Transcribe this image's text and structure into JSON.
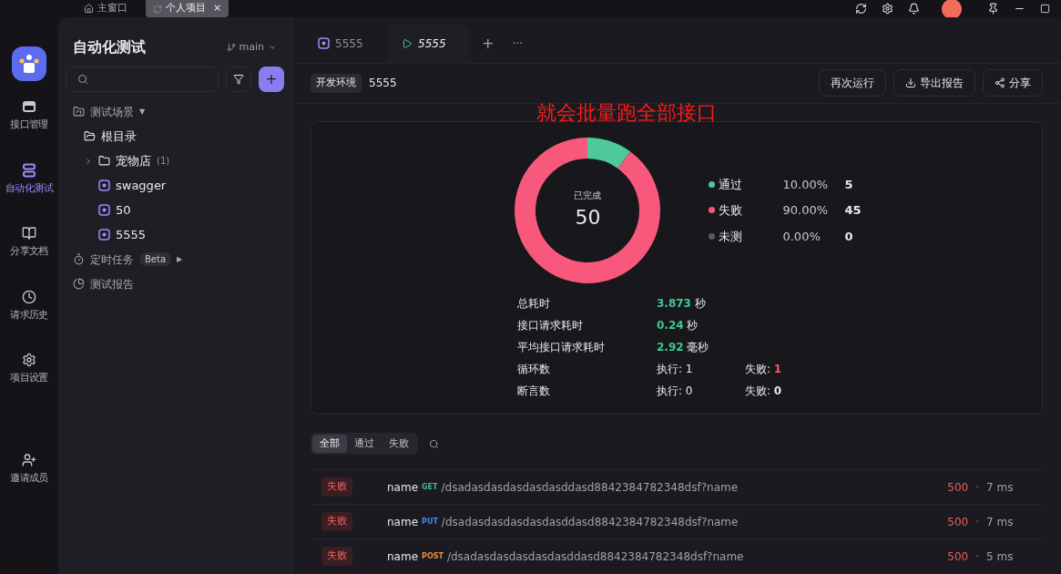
{
  "window_tabs": [
    {
      "label": "主窗口",
      "selected": false
    },
    {
      "label": "个人项目",
      "selected": true,
      "close": "×"
    }
  ],
  "rail": [
    {
      "label": "接口管理",
      "selected": false
    },
    {
      "label": "自动化测试",
      "selected": true
    },
    {
      "label": "分享文档",
      "selected": false
    },
    {
      "label": "请求历史",
      "selected": false
    },
    {
      "label": "项目设置",
      "selected": false
    },
    {
      "label": "邀请成员",
      "selected": false
    }
  ],
  "sidebar": {
    "title": "自动化测试",
    "branch": "main",
    "add": "+",
    "tree": [
      {
        "label": "测试场景",
        "kind": "section",
        "caret": "▼",
        "children": [
          {
            "label": "根目录",
            "kind": "folder",
            "expanded": true,
            "children": [
              {
                "label": "宠物店",
                "count": "(1)",
                "kind": "folder",
                "expanded": false
              },
              {
                "label": "swagger",
                "kind": "case"
              },
              {
                "label": "50",
                "kind": "case"
              },
              {
                "label": "5555",
                "kind": "case"
              }
            ]
          }
        ]
      },
      {
        "label": "定时任务",
        "badge": "Beta",
        "kind": "section",
        "caret": "▶"
      },
      {
        "label": "测试报告",
        "kind": "section"
      }
    ]
  },
  "tabs": [
    {
      "label": "5555",
      "kind": "case",
      "selected": false
    },
    {
      "label": "5555",
      "kind": "report",
      "selected": true
    }
  ],
  "tab_actions": {
    "add": "+",
    "more": "···"
  },
  "toolbar": {
    "env": "开发环境",
    "name": "5555",
    "buttons": [
      {
        "label": "再次运行"
      },
      {
        "label": "导出报告"
      },
      {
        "label": "分享"
      }
    ]
  },
  "caption": "就会批量跑全部接口",
  "summary": {
    "center_label": "已完成",
    "center_value": "50",
    "chart_data": {
      "type": "donut",
      "categories": [
        "通过",
        "失败",
        "未测"
      ],
      "values": [
        10,
        90,
        0
      ]
    },
    "legend": [
      {
        "percent": "10.00%",
        "count": "5",
        "color": "#4ec99a"
      },
      {
        "percent": "90.00%",
        "count": "45",
        "color": "#f7587c"
      },
      {
        "percent": "0.00%",
        "count": "0",
        "color": "#5a5a62"
      }
    ],
    "stats": [
      {
        "label": "总耗时",
        "value": "3.873",
        "unit": "秒"
      },
      {
        "label": "接口请求耗时",
        "value": "0.24",
        "unit": "秒"
      },
      {
        "label": "平均接口请求耗时",
        "value": "2.92",
        "unit": "毫秒"
      },
      {
        "label": "循环数",
        "run": "执行: 1",
        "failed_label": "失败: ",
        "failed": "1",
        "failed_alert": true
      },
      {
        "label": "断言数",
        "run": "执行: 0",
        "failed_label": "失败: ",
        "failed": "0",
        "failed_alert": false
      }
    ]
  },
  "filters": [
    {
      "label": "全部",
      "selected": true
    },
    {
      "label": "通过",
      "selected": false
    },
    {
      "label": "失败",
      "selected": false
    }
  ],
  "results": [
    {
      "status": "失败",
      "name": "name",
      "method": "GET",
      "path": "/dsadasdasdasdasdasddasd8842384782348dsf?name",
      "code": "500",
      "sep": "·",
      "time": "7 ms"
    },
    {
      "status": "失败",
      "name": "name",
      "method": "PUT",
      "path": "/dsadasdasdasdasdasddasd8842384782348dsf?name",
      "code": "500",
      "sep": "·",
      "time": "7 ms"
    },
    {
      "status": "失败",
      "name": "name",
      "method": "POST",
      "path": "/dsadasdasdasdasdasddasd8842384782348dsf?name",
      "code": "500",
      "sep": "·",
      "time": "5 ms"
    }
  ]
}
